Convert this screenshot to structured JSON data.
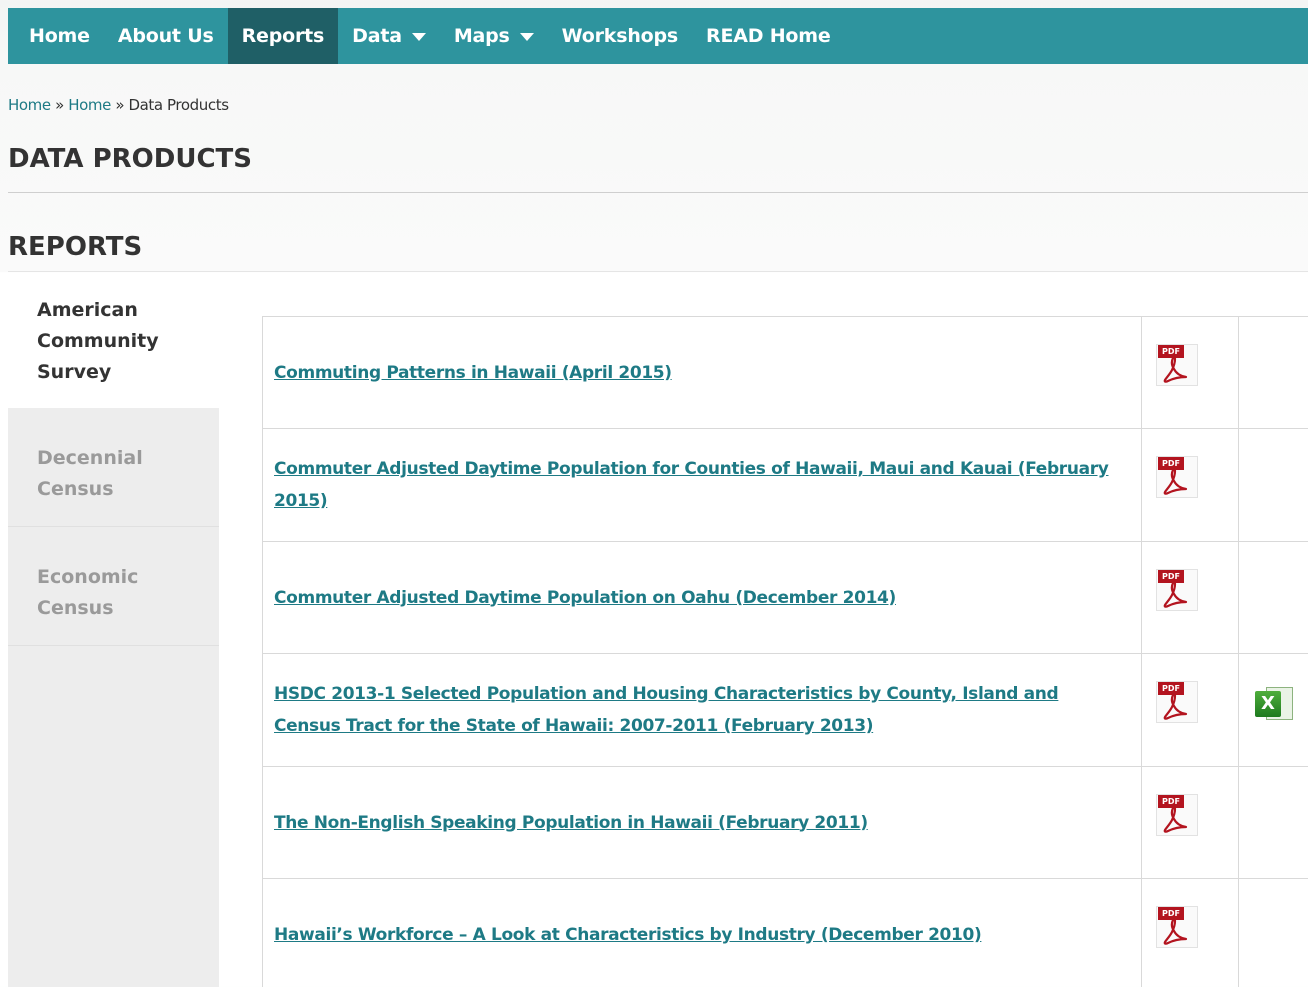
{
  "nav": {
    "items": [
      {
        "label": "Home"
      },
      {
        "label": "About Us"
      },
      {
        "label": "Reports"
      },
      {
        "label": "Data"
      },
      {
        "label": "Maps"
      },
      {
        "label": "Workshops"
      },
      {
        "label": "READ Home"
      }
    ],
    "active": "Reports"
  },
  "breadcrumb": {
    "items": [
      "Home",
      "Home",
      "Data Products"
    ],
    "separator": "»"
  },
  "page_title": "DATA PRODUCTS",
  "section_title": "REPORTS",
  "sidebar": {
    "items": [
      {
        "label": "American Community Survey",
        "active": true
      },
      {
        "label": "Decennial Census",
        "active": false
      },
      {
        "label": "Economic Census",
        "active": false
      }
    ]
  },
  "reports": [
    {
      "title": "Commuting Patterns in Hawaii (April 2015)",
      "pdf": true,
      "xls": false
    },
    {
      "title": "Commuter Adjusted Daytime Population for Counties of Hawaii, Maui and Kauai (February 2015)",
      "pdf": true,
      "xls": false
    },
    {
      "title": "Commuter Adjusted Daytime Population on Oahu (December 2014)",
      "pdf": true,
      "xls": false
    },
    {
      "title": "HSDC 2013-1 Selected Population and Housing Characteristics by County, Island and Census Tract for the State of Hawaii: 2007-2011 (February 2013)",
      "pdf": true,
      "xls": true
    },
    {
      "title": "The Non-English Speaking Population in Hawaii (February 2011)",
      "pdf": true,
      "xls": false
    },
    {
      "title": "Hawaii’s Workforce – A Look at Characteristics by Industry (December 2010)",
      "pdf": true,
      "xls": false
    }
  ],
  "icons": {
    "pdf_tag": "PDF",
    "xls_letter": "X",
    "pdf_color": "#b3141f",
    "xls_color": "#2e8b2e"
  },
  "colors": {
    "nav_bg": "#2e949e",
    "nav_active_bg": "#1f5f66",
    "link": "#1e7a85"
  }
}
